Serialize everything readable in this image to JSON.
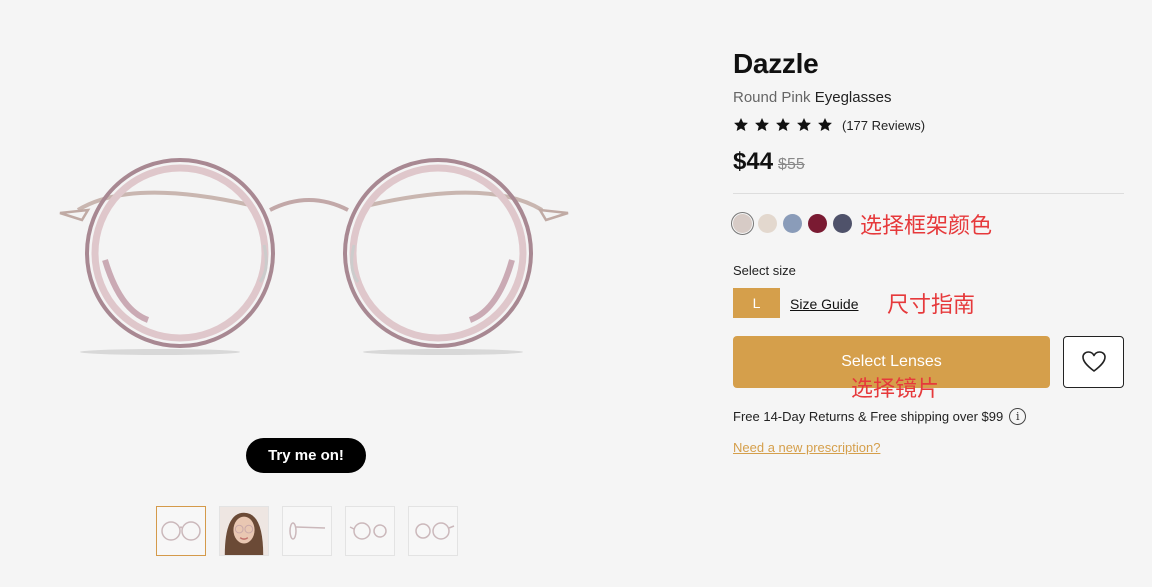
{
  "product": {
    "name": "Dazzle",
    "color_shape": "Round Pink",
    "category": "Eyeglasses",
    "rating_stars": 5,
    "reviews": "(177 Reviews)",
    "price": "$44",
    "original_price": "$55"
  },
  "gallery": {
    "try_on_label": "Try me on!",
    "thumbnails": [
      "front-view",
      "model-view",
      "side-view",
      "angle-view",
      "angle-view-2"
    ],
    "active_thumbnail": 0
  },
  "colors": {
    "swatches": [
      "#d7cbc6",
      "#e3d8ce",
      "#8a9cb9",
      "#7a1a32",
      "#4f526a"
    ],
    "selected": 0
  },
  "size": {
    "label": "Select size",
    "value": "L",
    "guide_label": "Size Guide"
  },
  "actions": {
    "select_lenses": "Select Lenses",
    "favorite_icon": "heart-icon"
  },
  "shipping": "Free 14-Day Returns & Free shipping over $99",
  "prescription_link": "Need a new prescription?",
  "annotations": {
    "color": "选择框架颜色",
    "size": "尺寸指南",
    "lens": "选择镜片"
  },
  "theme": {
    "accent": "#d59f4b",
    "annotation": "#e6393b"
  }
}
